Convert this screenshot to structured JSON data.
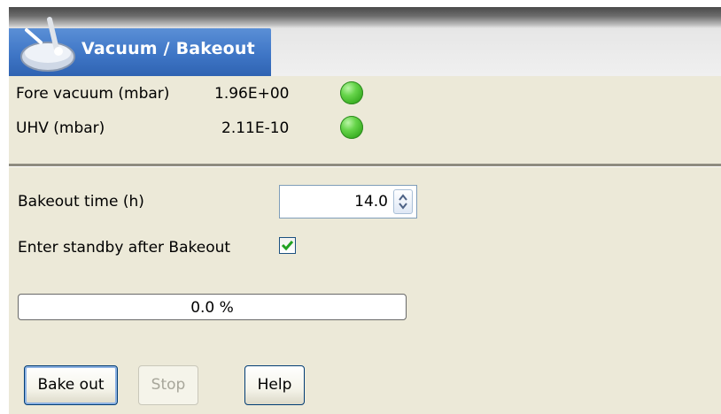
{
  "window": {
    "title": "Vacuum / Bakeout",
    "icon": "bakeout-app-icon"
  },
  "status": {
    "fore_vacuum": {
      "label": "Fore vacuum (mbar)",
      "value": "1.96E+00",
      "indicator": "green-led-icon",
      "indicator_color": "#3ec22a"
    },
    "uhv": {
      "label": "UHV (mbar)",
      "value": "2.11E-10",
      "indicator": "green-led-icon",
      "indicator_color": "#3ec22a"
    }
  },
  "bakeout": {
    "time_label": "Bakeout time (h)",
    "time_value": "14.0",
    "standby_label": "Enter standby after Bakeout",
    "standby_checked": true
  },
  "progress": {
    "text": "0.0 %",
    "fraction": 0.0
  },
  "buttons": {
    "bake_out": "Bake out",
    "stop": "Stop",
    "help": "Help"
  },
  "colors": {
    "title_blue": "#3f76c6",
    "panel_bg": "#ece9d8",
    "checkmark": "#21a121"
  }
}
